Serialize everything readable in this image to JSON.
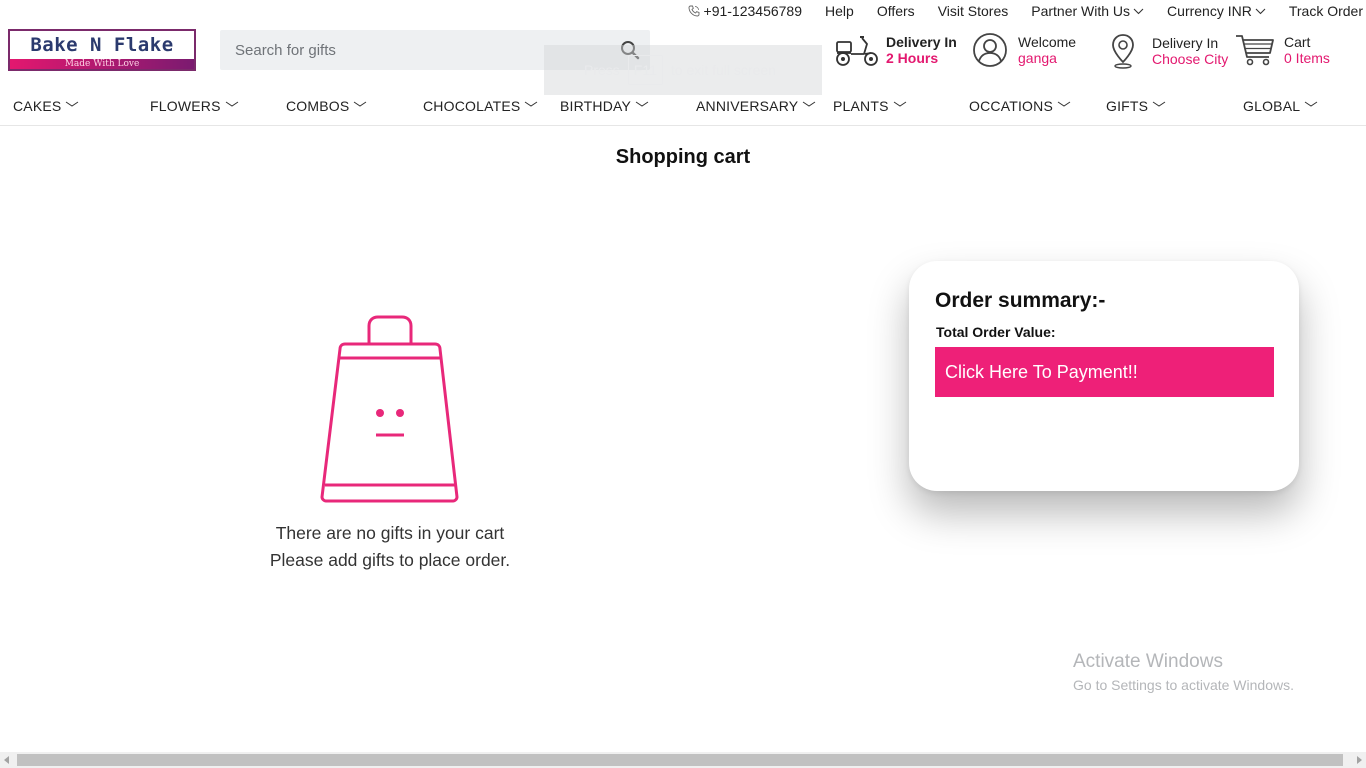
{
  "topbar": {
    "phone": "+91-123456789",
    "help": "Help",
    "offers": "Offers",
    "visit_stores": "Visit Stores",
    "partner": "Partner With Us",
    "currency": "Currency INR",
    "track_order": "Track Order"
  },
  "logo": {
    "name": "Bake N Flake",
    "tagline": "Made With Love"
  },
  "search": {
    "placeholder": "Search for gifts",
    "value": ""
  },
  "fullscreen_notice": {
    "prefix": "Press",
    "key": "F11",
    "suffix": "to exit full screen"
  },
  "header": {
    "delivery": {
      "line1": "Delivery In",
      "line2": "2 Hours"
    },
    "account": {
      "line1": "Welcome",
      "line2": "ganga"
    },
    "city": {
      "line1": "Delivery In",
      "line2": "Choose City"
    },
    "cart": {
      "line1": "Cart",
      "line2": "0 Items"
    }
  },
  "nav": {
    "items": [
      {
        "label": "CAKES"
      },
      {
        "label": "FLOWERS"
      },
      {
        "label": "COMBOS"
      },
      {
        "label": "CHOCOLATES"
      },
      {
        "label": "BIRTHDAY"
      },
      {
        "label": "ANNIVERSARY"
      },
      {
        "label": "PLANTS"
      },
      {
        "label": "OCCATIONS"
      },
      {
        "label": "GIFTS"
      },
      {
        "label": "GLOBAL"
      }
    ]
  },
  "main": {
    "title": "Shopping cart",
    "empty_line1": "There are no gifts in your cart",
    "empty_line2": "Please add gifts to place order."
  },
  "summary": {
    "title": "Order summary:-",
    "total_label": "Total Order Value:",
    "pay_button": "Click Here To Payment!!"
  },
  "watermark": {
    "line1": "Activate Windows",
    "line2": "Go to Settings to activate Windows."
  },
  "colors": {
    "accent": "#ee2078",
    "brand_pink": "#e3186f",
    "text": "#222222"
  }
}
